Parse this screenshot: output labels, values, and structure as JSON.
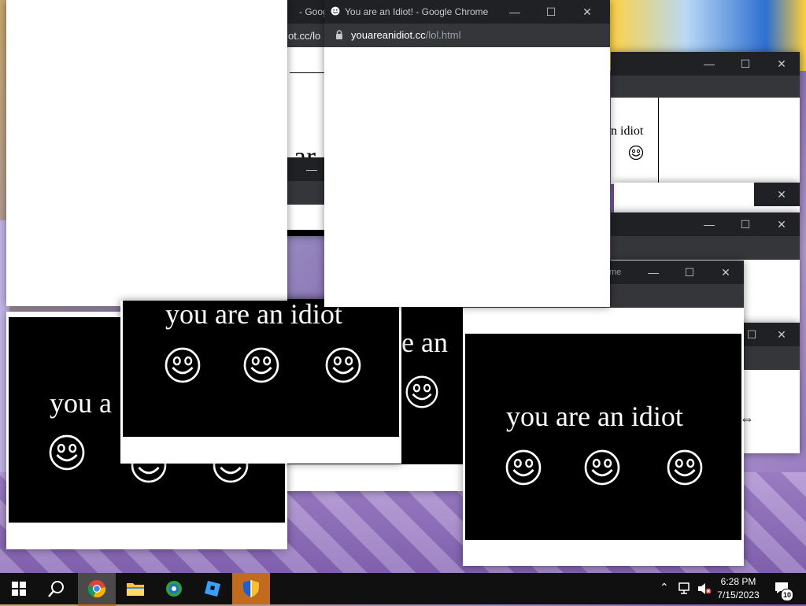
{
  "windows": {
    "main": {
      "title": "You are an Idiot! - Google Chrome",
      "url_domain": "youareanidiot.cc",
      "url_path": "/lol.html"
    },
    "behind_title_fragment": "- Goog",
    "behind_url_fragment": "ot.cc/lo",
    "right_title_fragment": "me",
    "idiot_text": "you are an idiot",
    "partial_text_1": "you a",
    "partial_text_2": "e an",
    "partial_text_3": "n idiot",
    "partial_text_4": "n ar"
  },
  "taskbar": {
    "time": "6:28 PM",
    "date": "7/15/2023",
    "notification_count": "10",
    "apps": [
      "start-button",
      "search",
      "chrome",
      "file-explorer",
      "photos",
      "roblox-studio",
      "security"
    ]
  },
  "colors": {
    "titlebar": "#202124",
    "addressbar": "#35363a",
    "taskbar": "#101010",
    "taskbar_accent": "#c26a1d"
  }
}
